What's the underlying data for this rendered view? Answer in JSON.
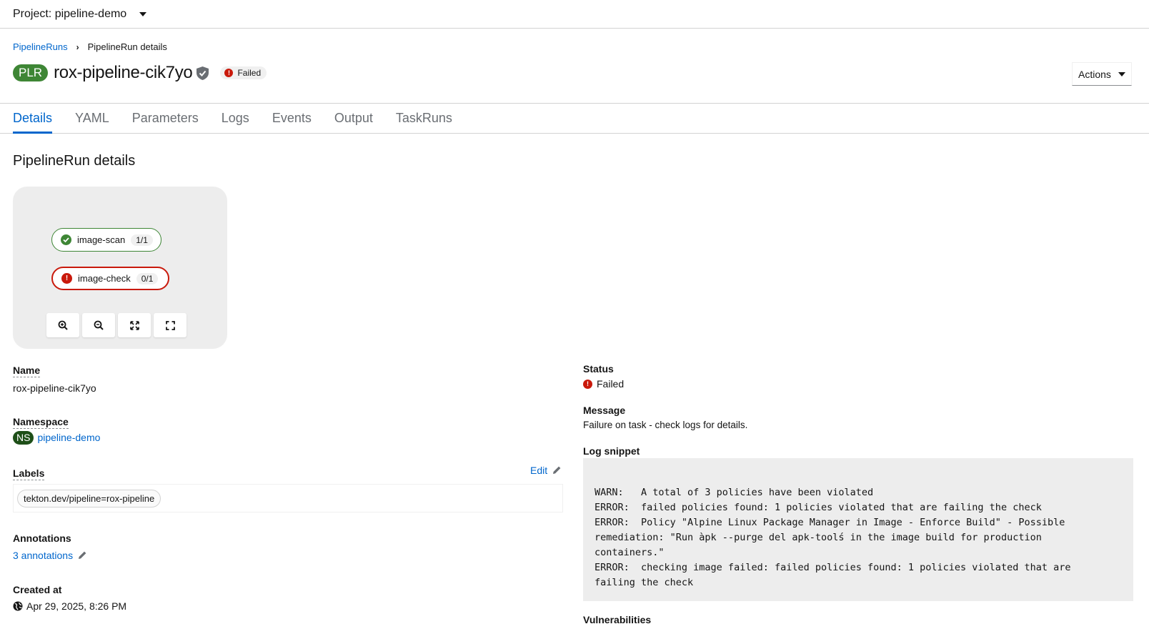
{
  "project": {
    "label": "Project: pipeline-demo"
  },
  "breadcrumb": {
    "parent": "PipelineRuns",
    "current": "PipelineRun details"
  },
  "header": {
    "badge": "PLR",
    "title": "rox-pipeline-cik7yo",
    "status": "Failed",
    "actions_label": "Actions"
  },
  "tabs": [
    "Details",
    "YAML",
    "Parameters",
    "Logs",
    "Events",
    "Output",
    "TaskRuns"
  ],
  "section_title": "PipelineRun details",
  "graph": {
    "tasks": [
      {
        "name": "image-scan",
        "count": "1/1",
        "state": "succeeded"
      },
      {
        "name": "image-check",
        "count": "0/1",
        "state": "failed"
      }
    ]
  },
  "details": {
    "name_label": "Name",
    "name_value": "rox-pipeline-cik7yo",
    "namespace_label": "Namespace",
    "namespace_badge": "NS",
    "namespace_value": "pipeline-demo",
    "labels_label": "Labels",
    "labels_edit": "Edit",
    "labels": [
      "tekton.dev/pipeline=rox-pipeline"
    ],
    "annotations_label": "Annotations",
    "annotations_value": "3 annotations",
    "created_label": "Created at",
    "created_value": "Apr 29, 2025, 8:26 PM"
  },
  "right": {
    "status_label": "Status",
    "status_value": "Failed",
    "message_label": "Message",
    "message_value": "Failure on task - check logs for details.",
    "log_label": "Log snippet",
    "log_lines": [
      "WARN:   A total of 3 policies have been violated",
      "ERROR:  failed policies found: 1 policies violated that are failing the check",
      "ERROR:  Policy \"Alpine Linux Package Manager in Image - Enforce Build\" - Possible\nremediation: \"Run àpk --purge del apk-toolś in the image build for production\ncontainers.\"",
      "ERROR:  checking image failed: failed policies found: 1 policies violated that are\nfailing the check"
    ],
    "vulns_label": "Vulnerabilities"
  },
  "colors": {
    "link": "#0066cc",
    "success": "#3e8635",
    "danger": "#c9190b"
  }
}
